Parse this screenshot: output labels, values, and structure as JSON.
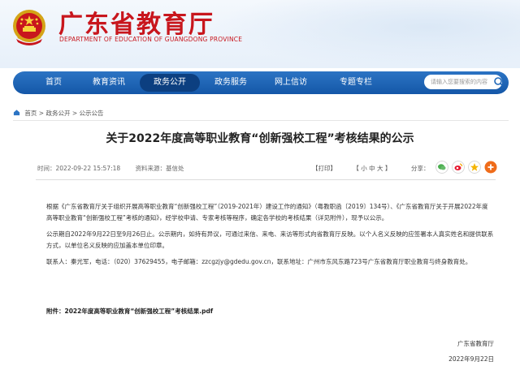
{
  "header": {
    "title": "广东省教育厅",
    "subtitle": "DEPARTMENT OF EDUCATION OF GUANGDONG PROVINCE"
  },
  "nav": {
    "items": [
      {
        "label": "首页"
      },
      {
        "label": "教育资讯"
      },
      {
        "label": "政务公开"
      },
      {
        "label": "政务服务"
      },
      {
        "label": "网上信访"
      },
      {
        "label": "专题专栏"
      }
    ],
    "active_index": 2,
    "search_placeholder": "请输入您要搜索的内容"
  },
  "breadcrumb": {
    "home": "首页",
    "sep1": ">",
    "level1": "政务公开",
    "sep2": ">",
    "level2": "公示公告"
  },
  "article": {
    "title": "关于2022年度高等职业教育“创新强校工程”考核结果的公示",
    "time": "时间：2022-09-22 15:57:18",
    "source": "资料来源：基信处",
    "print": "【打印】",
    "font_size": "【 小  中  大 】",
    "share_label": "分享：",
    "paragraphs": [
      "根据《广东省教育厅关于组织开展高等职业教育“创新强校工程”（2019-2021年）建设工作的通知》（粤教职函〔2019〕134号）、《广东省教育厅关于开展2022年度高等职业教育“创新强校工程”考核的通知》，经学校申请、专家考核等程序，确定各学校的考核结果（详见附件），现予以公示。",
      "公示期自2022年9月22日至9月26日止。公示期内，如持有异议，可通过来信、来电、来访等形式向省教育厅反映。以个人名义反映的应签署本人真实姓名和提供联系方式，以单位名义反映的应加盖本单位印章。",
      "联系人：秦光军，电话：（020）37629455，电子邮箱：zzcgzjy@gdedu.gov.cn，联系地址：广州市东风东路723号广东省教育厅职业教育与终身教育处。"
    ],
    "attachment": "附件：2022年度高等职业教育“创新强校工程”考核结果.pdf",
    "signature_org": "广东省教育厅",
    "signature_date": "2022年9月22日"
  },
  "colors": {
    "brand_red": "#c8161d",
    "nav_blue": "#1f67b8",
    "nav_active": "#0c3f80"
  },
  "icons": {
    "emblem": "national-emblem-icon",
    "search": "search-icon",
    "home": "home-icon",
    "share": [
      "wechat-icon",
      "weibo-icon",
      "qq-space-icon",
      "plus-share-icon"
    ]
  }
}
